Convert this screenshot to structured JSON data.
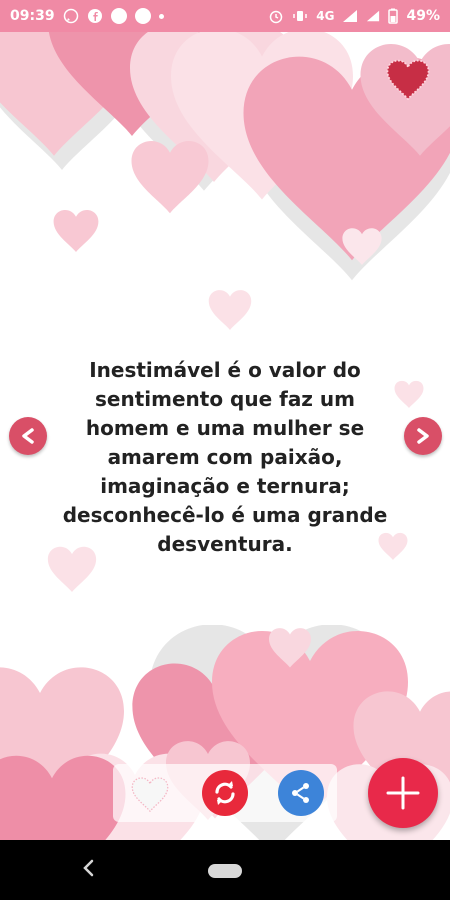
{
  "status": {
    "time": "09:39",
    "network": "4G",
    "battery": "49%"
  },
  "quote": {
    "text": "Inestimável é o valor do sentimento que faz um homem e uma mulher se amarem com paixão, imaginação e ternura; desconhecê-lo é uma grande desventura."
  },
  "icons": {
    "prev": "chevron-left-icon",
    "next": "chevron-right-icon",
    "favorite": "heart-outline-icon",
    "refresh": "refresh-icon",
    "share": "share-icon",
    "add": "plus-icon",
    "top_heart": "heart-icon"
  },
  "colors": {
    "status_bar": "#f08aa5",
    "arrow": "#d94f67",
    "refresh": "#e8293b",
    "share": "#3d84d9",
    "fab": "#e8294a",
    "heart_dark": "#c72e45"
  }
}
